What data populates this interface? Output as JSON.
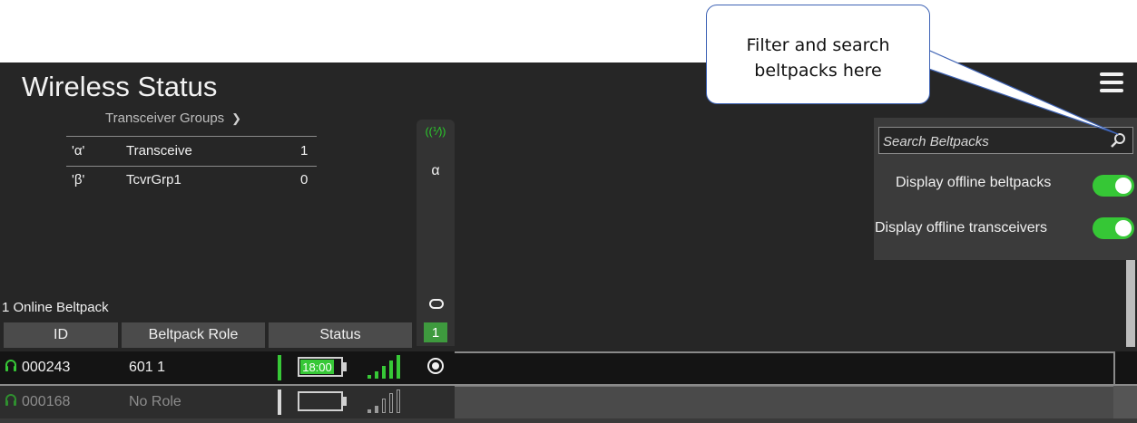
{
  "app": {
    "title": "Wireless Status"
  },
  "transceiver_groups": {
    "header": "Transceiver Groups",
    "rows": [
      {
        "symbol": "'α'",
        "name": "Transceive",
        "count": "1"
      },
      {
        "symbol": "'β'",
        "name": "TcvrGrp1",
        "count": "0"
      }
    ]
  },
  "transceiver_column": {
    "symbol": "α",
    "online_count": "1"
  },
  "beltpacks": {
    "summary": "1 Online Beltpack",
    "columns": [
      "ID",
      "Beltpack Role",
      "Status"
    ],
    "rows": [
      {
        "id": "000243",
        "role": "601 1",
        "battery_time": "18:00",
        "battery_level": 0.85,
        "signal_bars": 4,
        "online": true
      },
      {
        "id": "000168",
        "role": "No Role",
        "battery_time": "",
        "battery_level": 0,
        "signal_bars": 0,
        "online": false
      }
    ]
  },
  "filter_panel": {
    "search_placeholder": "Search Beltpacks",
    "display_offline_beltpacks": {
      "label": "Display offline beltpacks",
      "on": true
    },
    "display_offline_transceivers": {
      "label": "Display offline transceivers",
      "on": true
    }
  },
  "callout": {
    "line1": "Filter and search",
    "line2": "beltpacks here"
  },
  "colors": {
    "background": "#262626",
    "accent_green": "#37c837",
    "callout_border": "#3e63b5"
  },
  "icons": [
    "menu-icon",
    "chevron-down-icon",
    "antenna-icon",
    "headset-icon",
    "battery-icon",
    "signal-icon",
    "search-icon"
  ]
}
